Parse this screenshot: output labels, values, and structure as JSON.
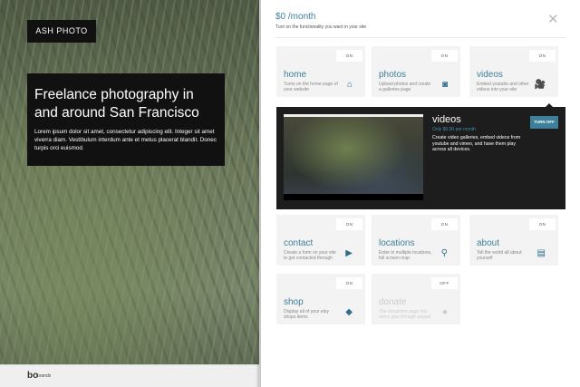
{
  "left": {
    "brand": "ASH PHOTO",
    "hero_title": "Freelance photography in and around San Francisco",
    "hero_text": "Lorem ipsum dolor sit amet, consectetur adipiscing elit. Integer sit amet viverra diam. Vestibulum interdum ante et metus placerat blandit. Donec turpis orci euismod.",
    "footer_logo": "bo",
    "footer_label": "brands"
  },
  "panel": {
    "price": "$0 /month",
    "subtitle": "Turn on the functionality you want in your site",
    "close": "✕"
  },
  "tiles": [
    {
      "name": "home",
      "desc": "Turns on the home page of your website",
      "toggle": "ON",
      "icon": "⌂"
    },
    {
      "name": "photos",
      "desc": "Upload photos and create a galleries page",
      "toggle": "ON",
      "icon": "◙"
    },
    {
      "name": "videos",
      "desc": "Embed youtube and other videos into your site",
      "toggle": "ON",
      "icon": "🎥"
    },
    {
      "name": "contact",
      "desc": "Create a form on your site to get contacted through",
      "toggle": "ON",
      "icon": "▶"
    },
    {
      "name": "locations",
      "desc": "Enter in multiple locations, full screen map",
      "toggle": "ON",
      "icon": "⚲"
    },
    {
      "name": "about",
      "desc": "Tell the world all about yourself",
      "toggle": "ON",
      "icon": "▤"
    },
    {
      "name": "shop",
      "desc": "Display all of your etsy shops items",
      "toggle": "ON",
      "icon": "◆"
    },
    {
      "name": "donate",
      "desc": "The donations page lets users give through paypal",
      "toggle": "OFF",
      "icon": "●"
    }
  ],
  "detail": {
    "title": "videos",
    "price": "Only $0.00 per month",
    "desc": "Create video galleries, embed videos from youtube and vimeo, and have them play across all devices.",
    "button": "TURN OFF"
  }
}
